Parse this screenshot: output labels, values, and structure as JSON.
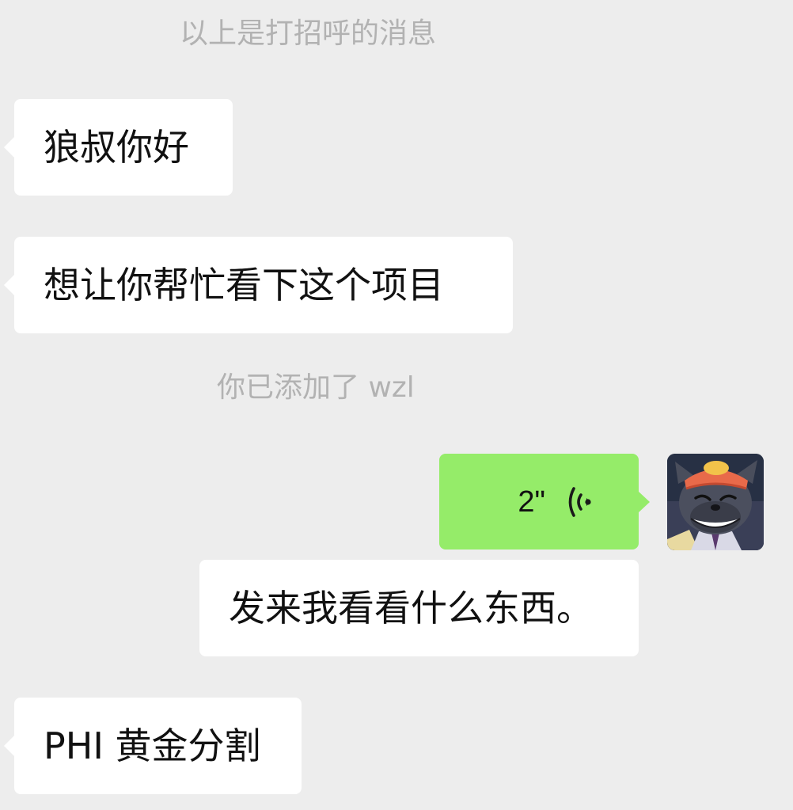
{
  "system": {
    "greeting_notice": "以上是打招呼的消息",
    "added_notice": "你已添加了 wzl"
  },
  "messages": {
    "m1": "狼叔你好",
    "m2": "想让你帮忙看下这个项目",
    "voice_duration": "2\"",
    "m4": "发来我看看什么东西。",
    "m5": "PHI 黄金分割"
  },
  "colors": {
    "background": "#ededed",
    "incoming_bubble": "#ffffff",
    "outgoing_bubble": "#95ec69",
    "system_text": "#b2b2b2"
  },
  "icons": {
    "voice": "voice-wave-icon",
    "avatar": "grey-wolf-cartoon-avatar"
  }
}
